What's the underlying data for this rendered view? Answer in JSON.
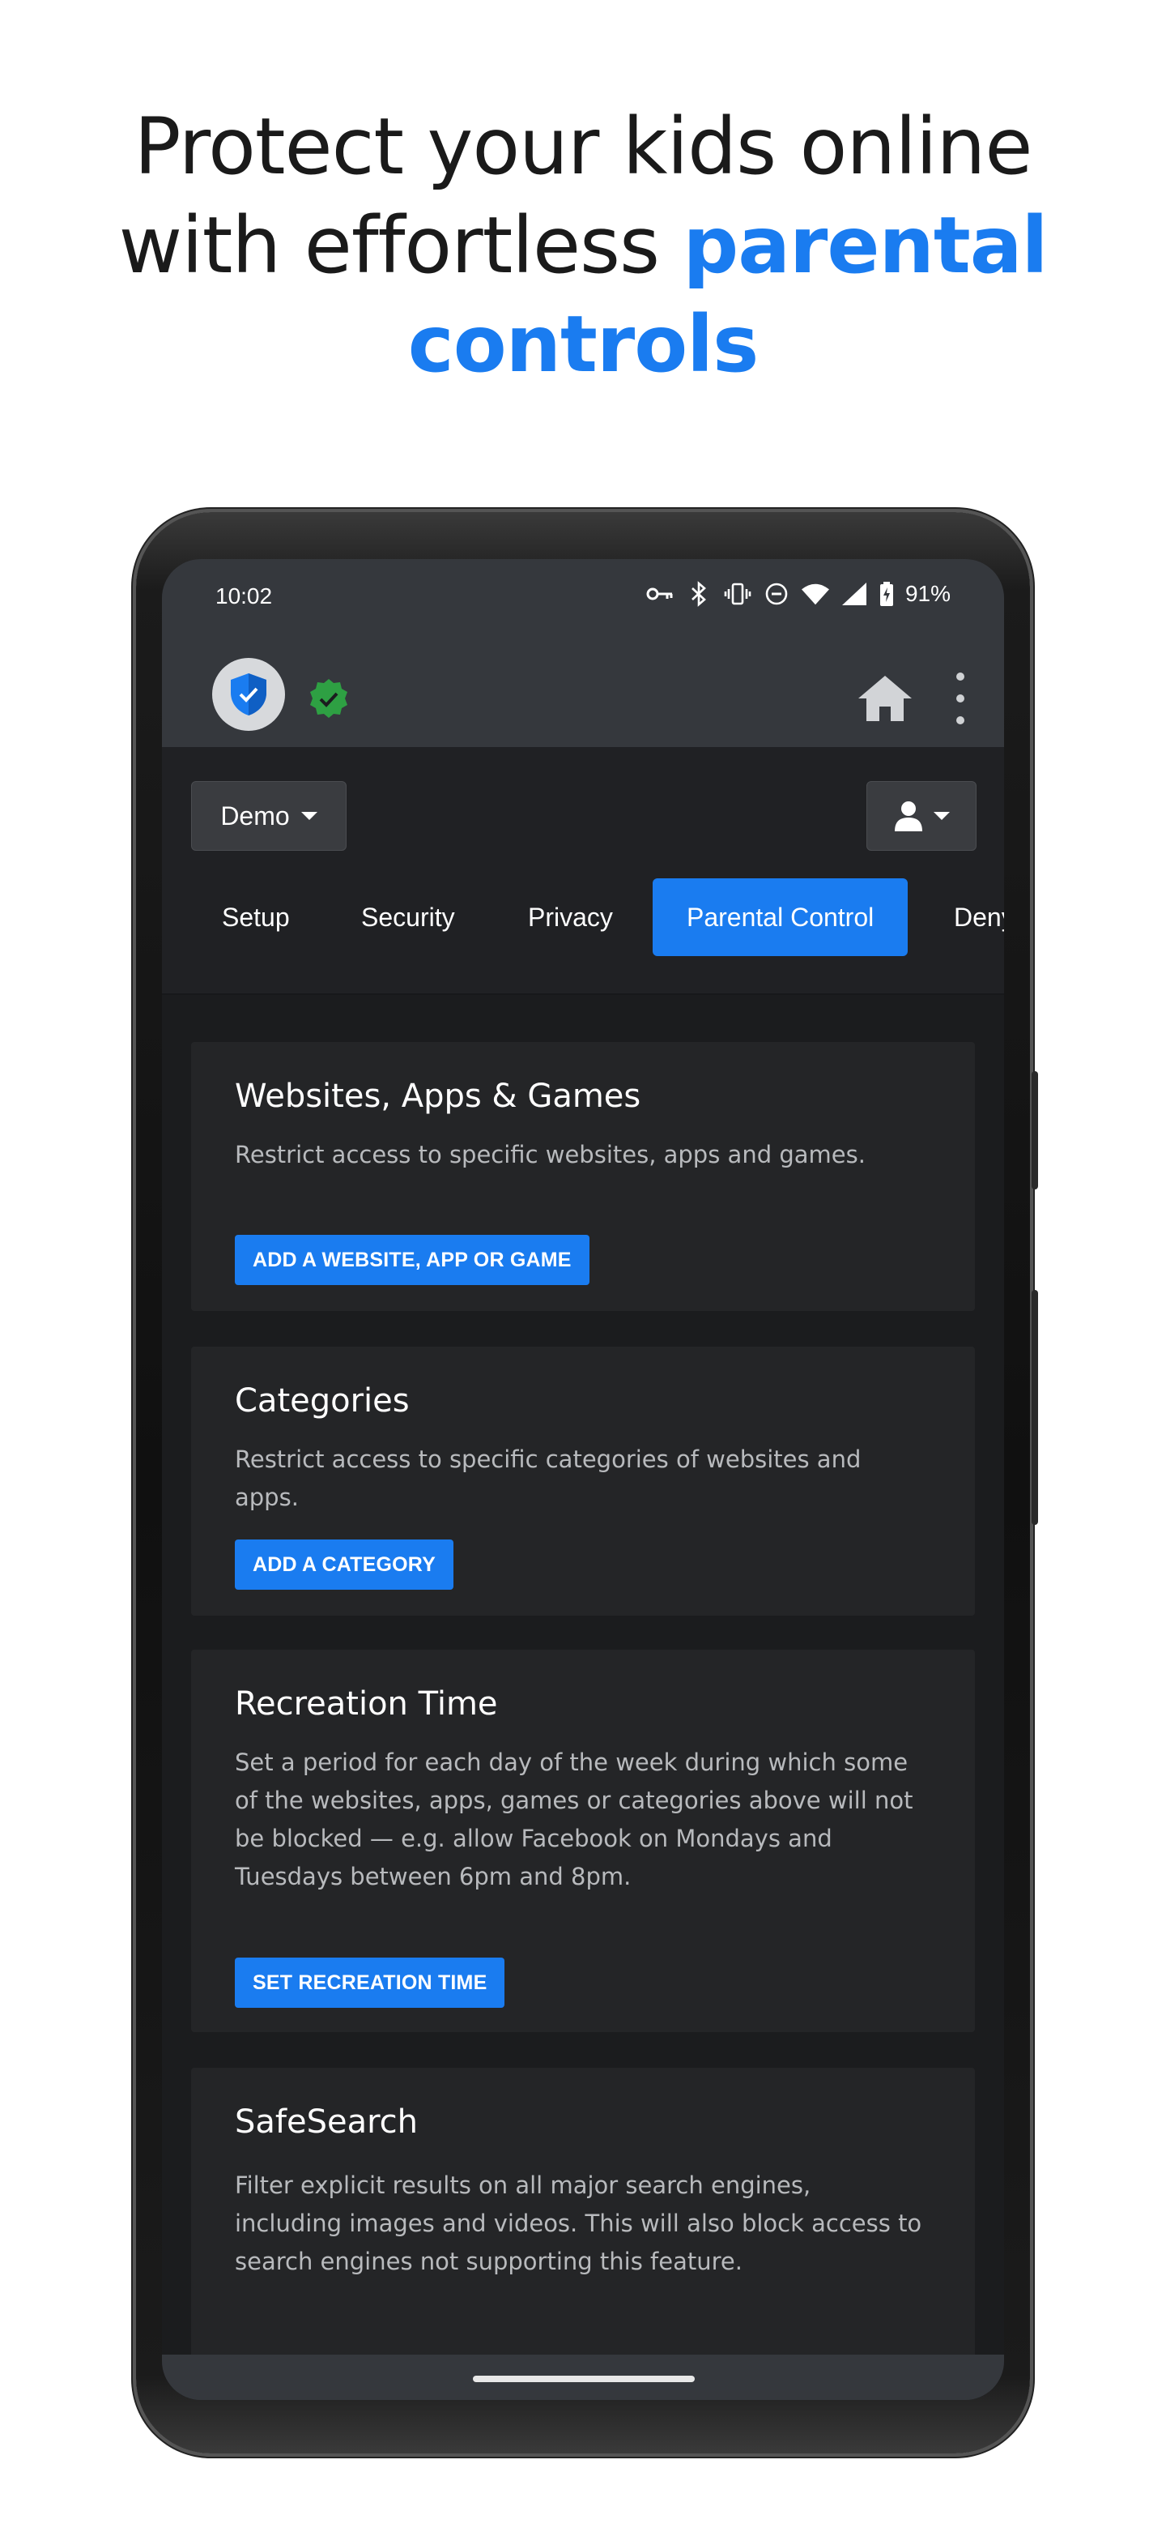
{
  "headline": {
    "line1": "Protect your kids online",
    "line2_plain": "with effortless ",
    "line2_accent": "parental",
    "line3_accent": "controls"
  },
  "status_bar": {
    "time": "10:02",
    "icons": [
      "vpn-key-icon",
      "bluetooth-icon",
      "vibrate-icon",
      "do-not-disturb-icon",
      "wifi-icon",
      "signal-icon",
      "battery-charging-icon"
    ],
    "battery": "91%"
  },
  "toolbar": {
    "profile_label": "Demo"
  },
  "tabs": [
    {
      "label": "Setup",
      "active": false
    },
    {
      "label": "Security",
      "active": false
    },
    {
      "label": "Privacy",
      "active": false
    },
    {
      "label": "Parental Control",
      "active": true
    },
    {
      "label": "Deny",
      "active": false
    }
  ],
  "cards": [
    {
      "title": "Websites, Apps & Games",
      "description": "Restrict access to specific websites, apps and games.",
      "button": "ADD A WEBSITE, APP OR GAME"
    },
    {
      "title": "Categories",
      "description": "Restrict access to specific categories of websites and apps.",
      "button": "ADD A CATEGORY"
    },
    {
      "title": "Recreation Time",
      "description": "Set a period for each day of the week during which some of the websites, apps, games or categories above will not be blocked — e.g. allow Facebook on Mondays and Tuesdays between 6pm and 8pm.",
      "button": "SET RECREATION TIME"
    },
    {
      "title": "SafeSearch",
      "description": "Filter explicit results on all major search engines, including images and videos. This will also block access to search engines not supporting this feature."
    }
  ],
  "colors": {
    "accent": "#1a7cf0",
    "background": "#1b1c1e",
    "card": "#242527",
    "appbar": "#35383d",
    "verified": "#2ea043"
  }
}
